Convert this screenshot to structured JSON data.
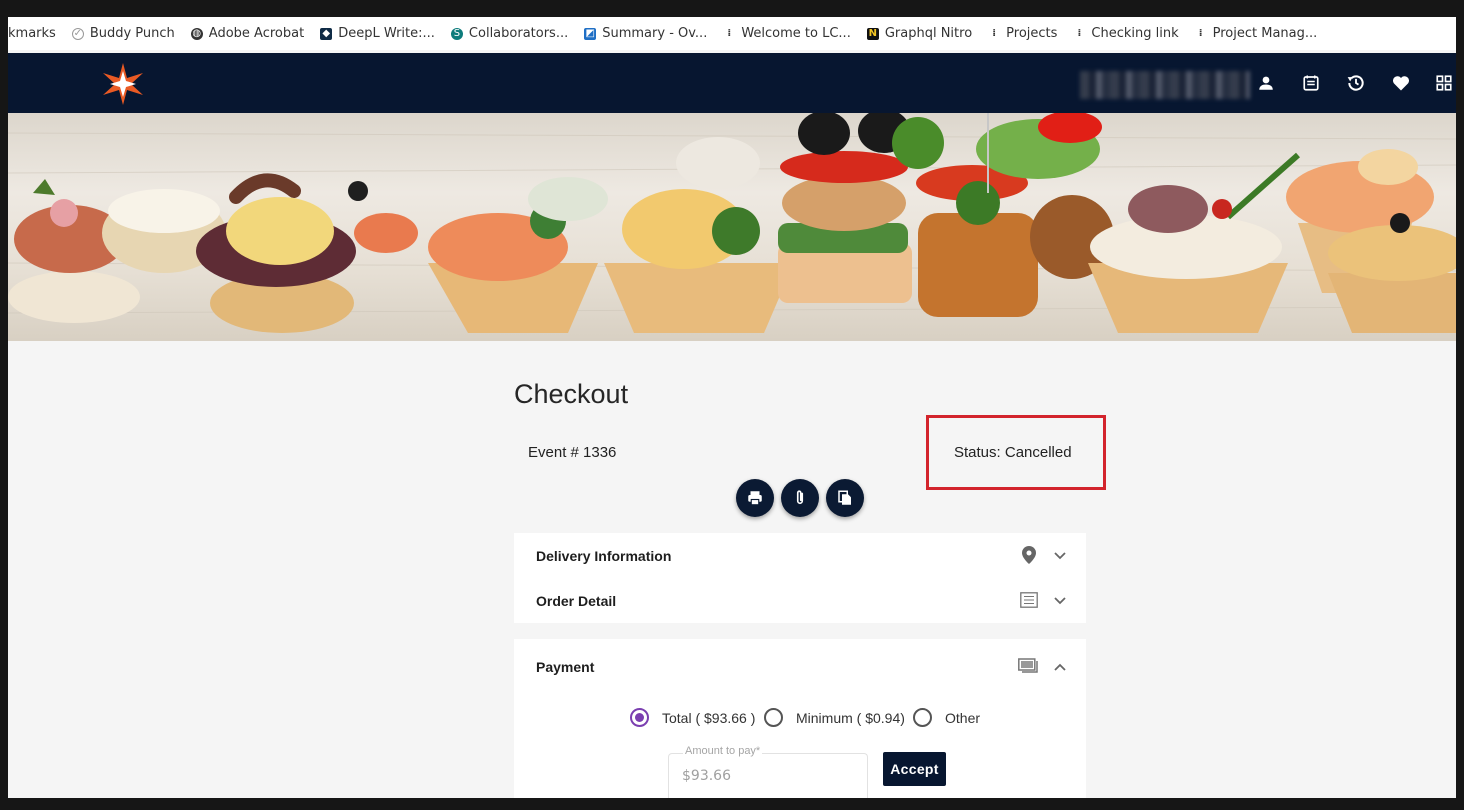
{
  "bookmarks": [
    {
      "label": "kmarks",
      "icon": "none"
    },
    {
      "label": "Buddy Punch",
      "icon": "check-circle-icon"
    },
    {
      "label": "Adobe Acrobat",
      "icon": "globe-icon"
    },
    {
      "label": "DeepL Write:...",
      "icon": "deepl-icon"
    },
    {
      "label": "Collaborators...",
      "icon": "sharepoint-icon"
    },
    {
      "label": "Summary - Ov...",
      "icon": "azure-icon"
    },
    {
      "label": "Welcome to LC...",
      "icon": "bookmark-icon"
    },
    {
      "label": "Graphql Nitro",
      "icon": "notion-icon"
    },
    {
      "label": "Projects",
      "icon": "bookmark-icon"
    },
    {
      "label": "Checking link",
      "icon": "bookmark-icon"
    },
    {
      "label": "Project Manag...",
      "icon": "bookmark-icon"
    }
  ],
  "navbar": {
    "icons": [
      "user-icon",
      "calendar-icon",
      "history-icon",
      "heart-icon",
      "apps-grid-icon"
    ]
  },
  "checkout": {
    "title": "Checkout",
    "event": "Event # 1336",
    "status": "Status: Cancelled"
  },
  "actions": [
    "print-icon",
    "attach-icon",
    "copy-icon"
  ],
  "sections": {
    "delivery": "Delivery Information",
    "order": "Order Detail",
    "payment": "Payment"
  },
  "payment": {
    "options": [
      "Total ( $93.66 )",
      "Minimum ( $0.94)",
      "Other"
    ],
    "selected": "Total ( $93.66 )",
    "amount_label": "Amount to pay*",
    "amount_value": "$93.66",
    "accept_label": "Accept"
  },
  "colors": {
    "navbar": "#071630",
    "status_highlight": "#d3242c",
    "radio_selected": "#7b3fb0"
  }
}
